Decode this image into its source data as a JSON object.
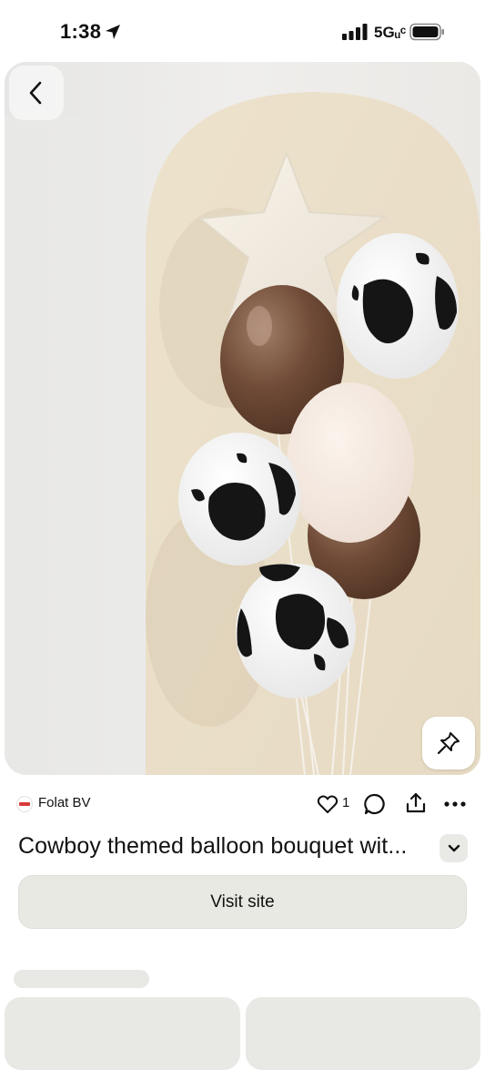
{
  "status_bar": {
    "time": "1:38",
    "network": "5Gᵤᶜ"
  },
  "pin": {
    "creator_name": "Folat BV",
    "like_count": "1",
    "title": "Cowboy themed balloon bouquet wit...",
    "visit_label": "Visit site"
  },
  "icons": {
    "back": "chevron-left-icon",
    "save": "pushpin-icon",
    "like": "heart-outline-icon",
    "comment": "speech-bubble-icon",
    "share": "share-upload-icon",
    "more": "ellipsis-icon",
    "expand": "chevron-down-icon"
  },
  "colors": {
    "background": "#ffffff",
    "button_gray": "#e9e9e4",
    "skeleton": "#e8e8e5",
    "text": "#111111"
  }
}
